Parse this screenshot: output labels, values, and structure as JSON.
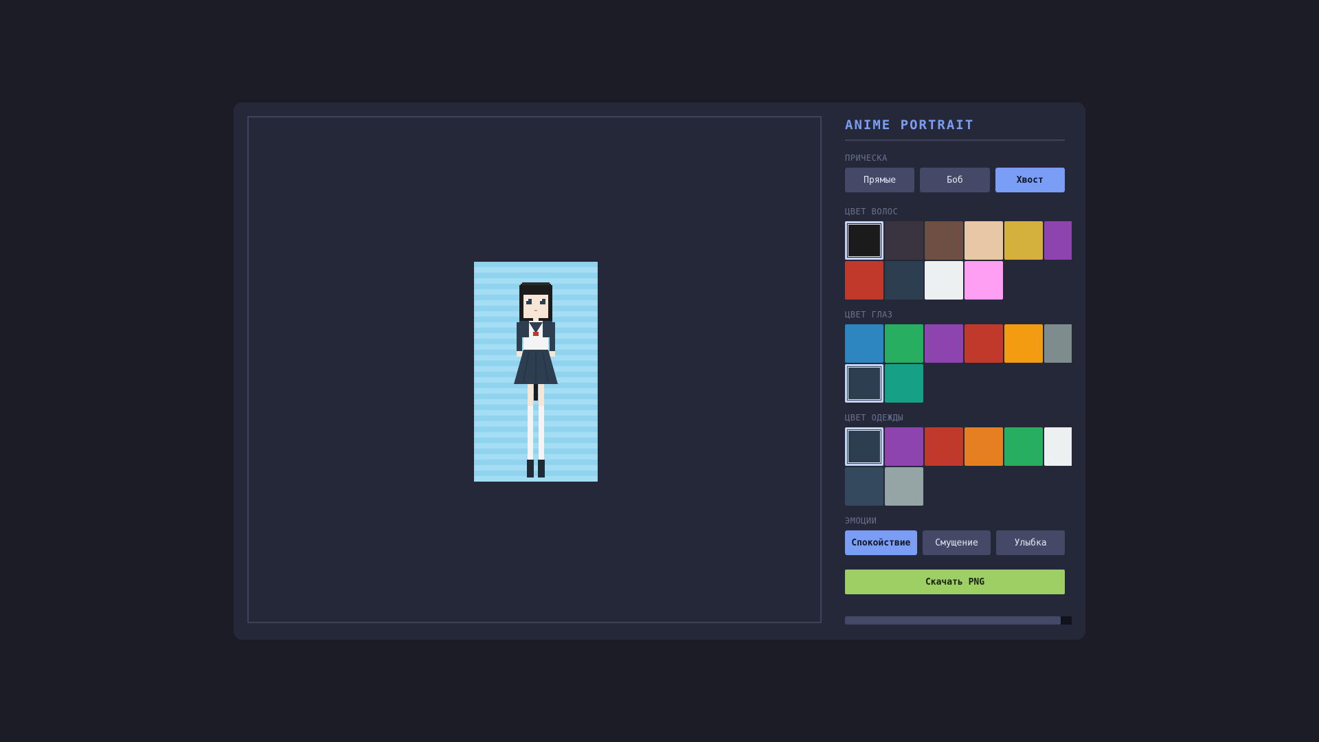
{
  "title": "ANIME PORTRAIT",
  "hairstyle": {
    "label": "ПРИЧЕСКА",
    "options": [
      "Прямые",
      "Боб",
      "Хвост"
    ],
    "selected": 2
  },
  "hair_color": {
    "label": "ЦВЕТ ВОЛОС",
    "swatches": [
      "#1b1b1b",
      "#3a3340",
      "#6e4f43",
      "#e8c8a4",
      "#d4b13c",
      "#8e44ad",
      "#c0392b",
      "#2c3e50",
      "#ecf0f1",
      "#ff9ff3"
    ],
    "selected": 0
  },
  "eye_color": {
    "label": "ЦВЕТ ГЛАЗ",
    "swatches": [
      "#2e86c1",
      "#27ae60",
      "#8e44ad",
      "#c0392b",
      "#f39c12",
      "#7f8c8d",
      "#2c3e50",
      "#16a085"
    ],
    "selected": 6
  },
  "clothes_color": {
    "label": "ЦВЕТ ОДЕЖДЫ",
    "swatches": [
      "#2c3e50",
      "#8e44ad",
      "#c0392b",
      "#e67e22",
      "#27ae60",
      "#ecf0f1",
      "#34495e",
      "#95a5a6"
    ],
    "selected": 0
  },
  "emotion": {
    "label": "ЭМОЦИИ",
    "options": [
      "Спокойствие",
      "Смущение",
      "Улыбка"
    ],
    "selected": 0
  },
  "download_label": "Скачать PNG",
  "colors": {
    "accent": "#7a9df5",
    "download": "#9ecf64",
    "background": "#1b1c26",
    "panel": "#242838"
  },
  "character": {
    "skin": "#f7e6d6",
    "shirt": "#f4f4f4",
    "bow": "#c0392b",
    "shoes": "#1f2a36"
  }
}
